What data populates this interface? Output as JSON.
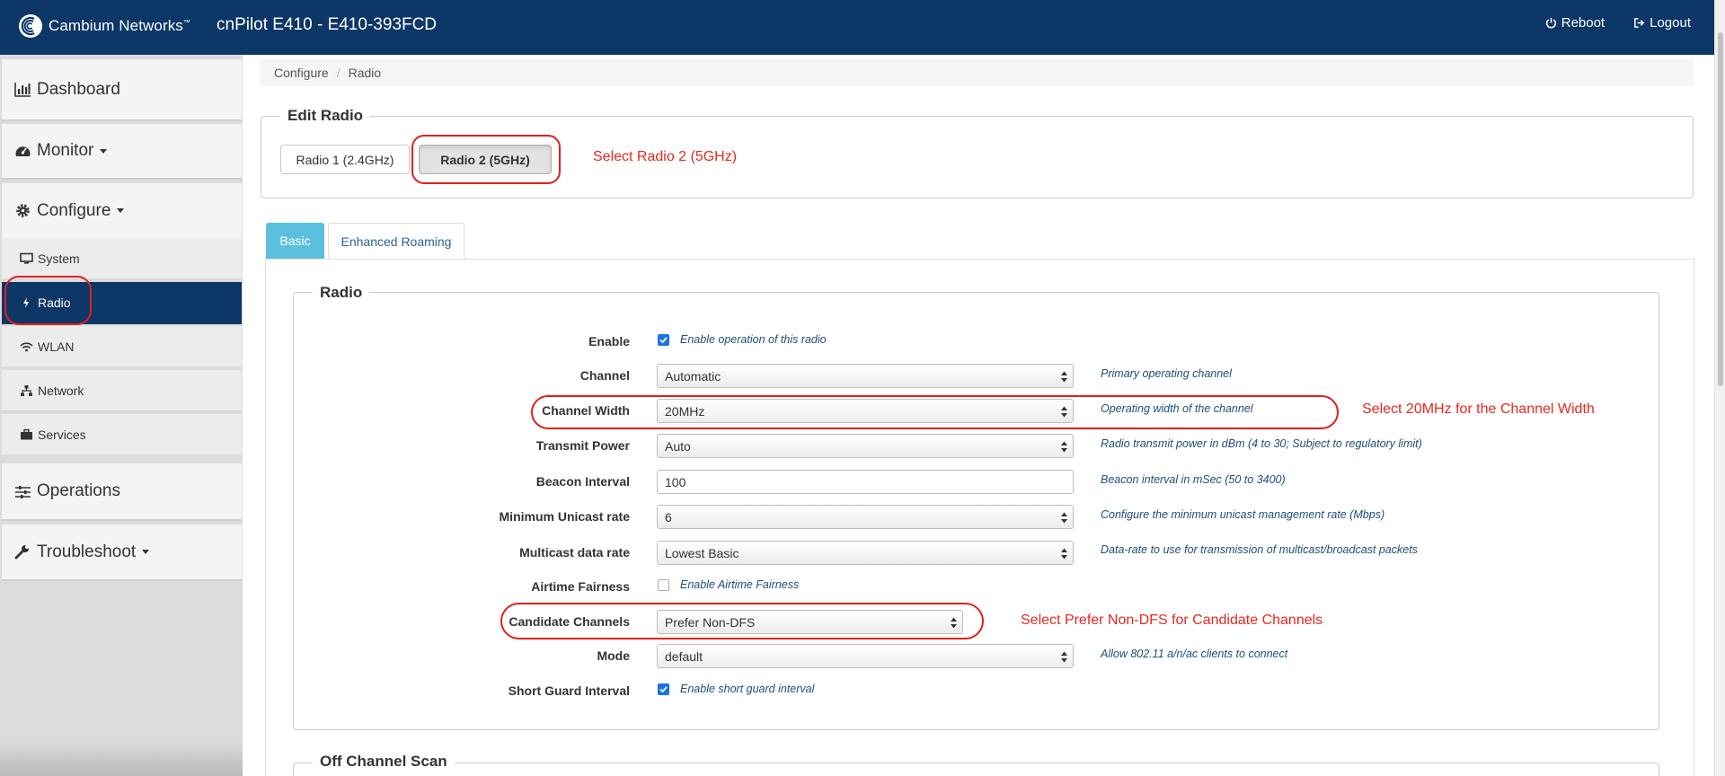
{
  "header": {
    "brand_name": "Cambium Networks",
    "brand_tm": "™",
    "device_title": "cnPilot E410 - E410-393FCD",
    "reboot_label": "Reboot",
    "logout_label": "Logout"
  },
  "sidebar": {
    "dashboard": "Dashboard",
    "monitor": "Monitor",
    "configure": "Configure",
    "configure_items": [
      "System",
      "Radio",
      "WLAN",
      "Network",
      "Services"
    ],
    "operations": "Operations",
    "troubleshoot": "Troubleshoot",
    "active_item": "Radio"
  },
  "breadcrumb": {
    "parent": "Configure",
    "separator": "/",
    "current": "Radio"
  },
  "edit_radio": {
    "legend": "Edit Radio",
    "radio1_label": "Radio 1 (2.4GHz)",
    "radio2_label": "Radio 2 (5GHz)",
    "selected": "Radio 2 (5GHz)"
  },
  "tabs": {
    "basic": "Basic",
    "enhanced_roaming": "Enhanced Roaming",
    "active": "Basic"
  },
  "radio_section": {
    "legend": "Radio",
    "enable": {
      "label": "Enable",
      "checked": true,
      "text": "Enable operation of this radio"
    },
    "channel": {
      "label": "Channel",
      "value": "Automatic",
      "help": "Primary operating channel"
    },
    "channel_width": {
      "label": "Channel Width",
      "value": "20MHz",
      "help": "Operating width of the channel"
    },
    "transmit_power": {
      "label": "Transmit Power",
      "value": "Auto",
      "help": "Radio transmit power in dBm (4 to 30; Subject to regulatory limit)"
    },
    "beacon_interval": {
      "label": "Beacon Interval",
      "value": "100",
      "help": "Beacon interval in mSec (50 to 3400)"
    },
    "min_unicast_rate": {
      "label": "Minimum Unicast rate",
      "value": "6",
      "help": "Configure the minimum unicast management rate (Mbps)"
    },
    "multicast_rate": {
      "label": "Multicast data rate",
      "value": "Lowest Basic",
      "help": "Data-rate to use for transmission of multicast/broadcast packets"
    },
    "airtime_fairness": {
      "label": "Airtime Fairness",
      "checked": false,
      "text": "Enable Airtime Fairness"
    },
    "candidate_channels": {
      "label": "Candidate Channels",
      "value": "Prefer Non-DFS"
    },
    "mode": {
      "label": "Mode",
      "value": "default",
      "help": "Allow 802.11 a/n/ac clients to connect"
    },
    "short_guard": {
      "label": "Short Guard Interval",
      "checked": true,
      "text": "Enable short guard interval"
    }
  },
  "off_channel_scan": {
    "legend": "Off Channel Scan"
  },
  "annotations": {
    "select_radio2": "Select Radio 2 (5GHz)",
    "select_channel_width": "Select 20MHz for the Channel Width",
    "select_candidate": "Select Prefer Non-DFS for Candidate Channels"
  },
  "colors": {
    "header_bg": "#0c3766",
    "tab_active": "#5bc0de",
    "annotation": "#e0211b",
    "checkbox": "#1a73e8"
  }
}
